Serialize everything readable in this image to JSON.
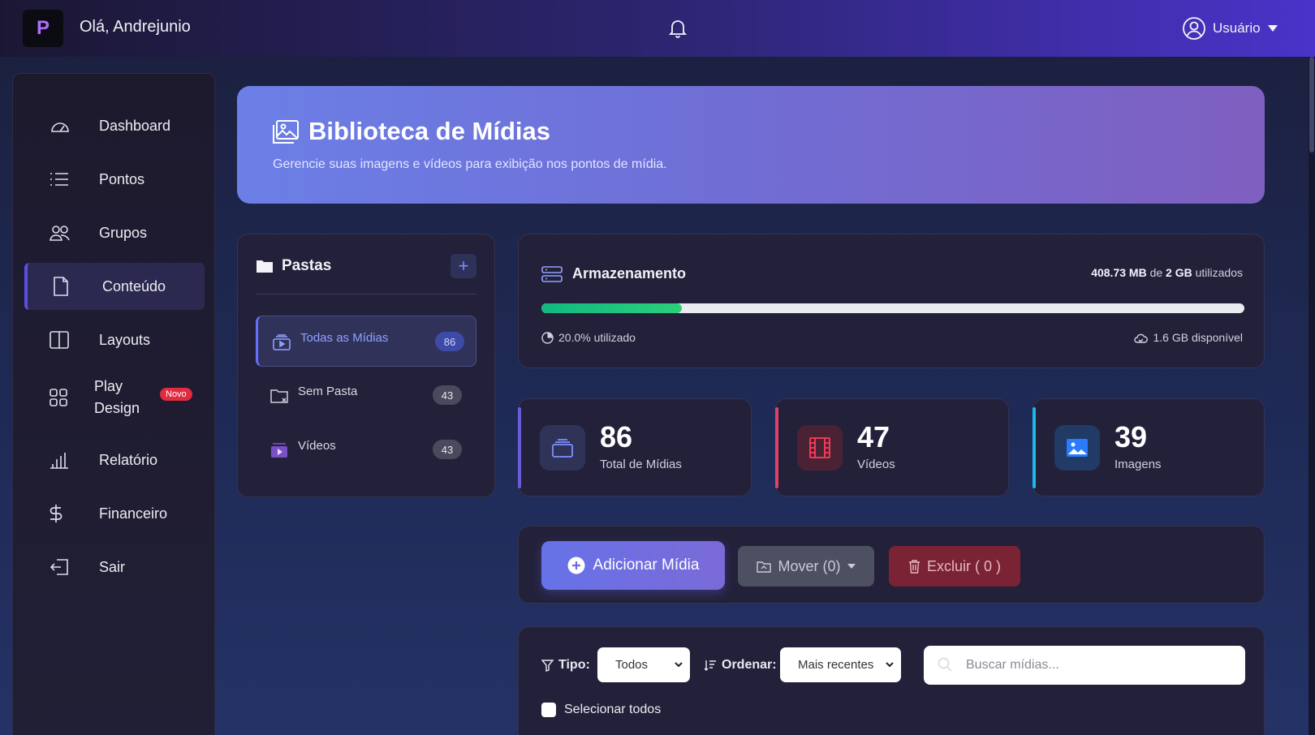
{
  "header": {
    "logo_text": "P",
    "greeting": "Olá, Andrejunio",
    "user_label": "Usuário"
  },
  "sidebar": {
    "items": [
      {
        "label": "Dashboard",
        "icon": "speedometer-icon"
      },
      {
        "label": "Pontos",
        "icon": "list-icon"
      },
      {
        "label": "Grupos",
        "icon": "people-icon"
      },
      {
        "label": "Conteúdo",
        "icon": "file-icon",
        "active": true
      },
      {
        "label": "Layouts",
        "icon": "layout-icon"
      },
      {
        "label": "Play Design",
        "icon": "grid-icon",
        "badge": "Novo"
      },
      {
        "label": "Relatório",
        "icon": "bar-chart-icon"
      },
      {
        "label": "Financeiro",
        "icon": "dollar-icon"
      },
      {
        "label": "Sair",
        "icon": "logout-icon"
      }
    ]
  },
  "hero": {
    "title": "Biblioteca de Mídias",
    "subtitle": "Gerencie suas imagens e vídeos para exibição nos pontos de mídia."
  },
  "folders": {
    "title": "Pastas",
    "add_label": "+",
    "items": [
      {
        "label": "Todas as Mídias",
        "count": "86",
        "active": true
      },
      {
        "label": "Sem Pasta",
        "count": "43"
      },
      {
        "label": "Vídeos",
        "count": "43"
      }
    ]
  },
  "storage": {
    "title": "Armazenamento",
    "used": "408.73 MB",
    "of": "de",
    "total": "2 GB",
    "used_suffix": "utilizados",
    "percent_text": "20.0% utilizado",
    "percent_value": 20.0,
    "available_text": "1.6 GB disponível"
  },
  "stats": [
    {
      "value": "86",
      "label": "Total de Mídias",
      "color": "#6a5cd6",
      "icon": "layers-icon"
    },
    {
      "value": "47",
      "label": "Vídeos",
      "color": "#e0406a",
      "icon": "film-icon"
    },
    {
      "value": "39",
      "label": "Imagens",
      "color": "#1fb6e8",
      "icon": "image-icon"
    }
  ],
  "actions": {
    "add_label": "Adicionar Mídia",
    "move_label": "Mover (0)",
    "delete_label": "Excluir ( 0 )"
  },
  "filters": {
    "type_label": "Tipo:",
    "type_value": "Todos",
    "sort_label": "Ordenar:",
    "sort_value": "Mais recentes",
    "search_placeholder": "Buscar mídias...",
    "select_all_label": "Selecionar todos"
  }
}
